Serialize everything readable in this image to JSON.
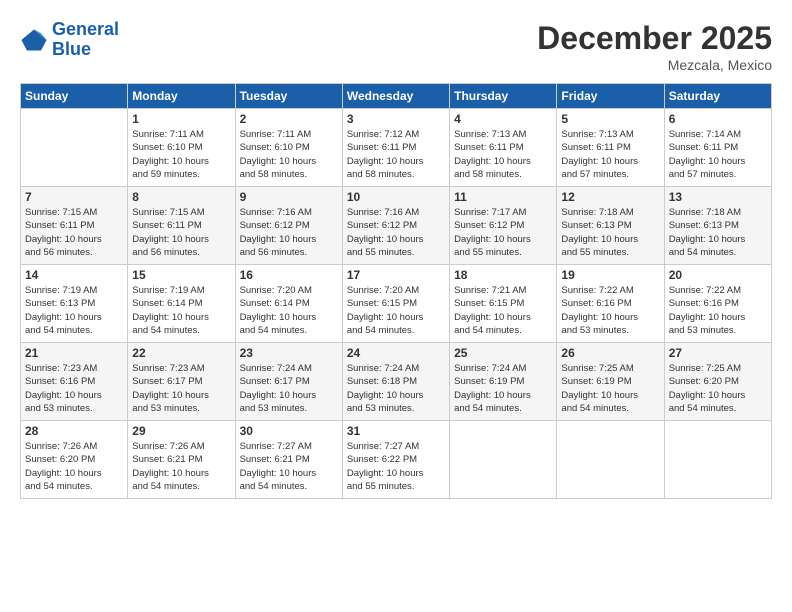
{
  "logo": {
    "line1": "General",
    "line2": "Blue"
  },
  "title": "December 2025",
  "location": "Mezcala, Mexico",
  "days_of_week": [
    "Sunday",
    "Monday",
    "Tuesday",
    "Wednesday",
    "Thursday",
    "Friday",
    "Saturday"
  ],
  "weeks": [
    [
      {
        "num": "",
        "sunrise": "",
        "sunset": "",
        "daylight": ""
      },
      {
        "num": "1",
        "sunrise": "Sunrise: 7:11 AM",
        "sunset": "Sunset: 6:10 PM",
        "daylight": "Daylight: 10 hours and 59 minutes."
      },
      {
        "num": "2",
        "sunrise": "Sunrise: 7:11 AM",
        "sunset": "Sunset: 6:10 PM",
        "daylight": "Daylight: 10 hours and 58 minutes."
      },
      {
        "num": "3",
        "sunrise": "Sunrise: 7:12 AM",
        "sunset": "Sunset: 6:11 PM",
        "daylight": "Daylight: 10 hours and 58 minutes."
      },
      {
        "num": "4",
        "sunrise": "Sunrise: 7:13 AM",
        "sunset": "Sunset: 6:11 PM",
        "daylight": "Daylight: 10 hours and 58 minutes."
      },
      {
        "num": "5",
        "sunrise": "Sunrise: 7:13 AM",
        "sunset": "Sunset: 6:11 PM",
        "daylight": "Daylight: 10 hours and 57 minutes."
      },
      {
        "num": "6",
        "sunrise": "Sunrise: 7:14 AM",
        "sunset": "Sunset: 6:11 PM",
        "daylight": "Daylight: 10 hours and 57 minutes."
      }
    ],
    [
      {
        "num": "7",
        "sunrise": "Sunrise: 7:15 AM",
        "sunset": "Sunset: 6:11 PM",
        "daylight": "Daylight: 10 hours and 56 minutes."
      },
      {
        "num": "8",
        "sunrise": "Sunrise: 7:15 AM",
        "sunset": "Sunset: 6:11 PM",
        "daylight": "Daylight: 10 hours and 56 minutes."
      },
      {
        "num": "9",
        "sunrise": "Sunrise: 7:16 AM",
        "sunset": "Sunset: 6:12 PM",
        "daylight": "Daylight: 10 hours and 56 minutes."
      },
      {
        "num": "10",
        "sunrise": "Sunrise: 7:16 AM",
        "sunset": "Sunset: 6:12 PM",
        "daylight": "Daylight: 10 hours and 55 minutes."
      },
      {
        "num": "11",
        "sunrise": "Sunrise: 7:17 AM",
        "sunset": "Sunset: 6:12 PM",
        "daylight": "Daylight: 10 hours and 55 minutes."
      },
      {
        "num": "12",
        "sunrise": "Sunrise: 7:18 AM",
        "sunset": "Sunset: 6:13 PM",
        "daylight": "Daylight: 10 hours and 55 minutes."
      },
      {
        "num": "13",
        "sunrise": "Sunrise: 7:18 AM",
        "sunset": "Sunset: 6:13 PM",
        "daylight": "Daylight: 10 hours and 54 minutes."
      }
    ],
    [
      {
        "num": "14",
        "sunrise": "Sunrise: 7:19 AM",
        "sunset": "Sunset: 6:13 PM",
        "daylight": "Daylight: 10 hours and 54 minutes."
      },
      {
        "num": "15",
        "sunrise": "Sunrise: 7:19 AM",
        "sunset": "Sunset: 6:14 PM",
        "daylight": "Daylight: 10 hours and 54 minutes."
      },
      {
        "num": "16",
        "sunrise": "Sunrise: 7:20 AM",
        "sunset": "Sunset: 6:14 PM",
        "daylight": "Daylight: 10 hours and 54 minutes."
      },
      {
        "num": "17",
        "sunrise": "Sunrise: 7:20 AM",
        "sunset": "Sunset: 6:15 PM",
        "daylight": "Daylight: 10 hours and 54 minutes."
      },
      {
        "num": "18",
        "sunrise": "Sunrise: 7:21 AM",
        "sunset": "Sunset: 6:15 PM",
        "daylight": "Daylight: 10 hours and 54 minutes."
      },
      {
        "num": "19",
        "sunrise": "Sunrise: 7:22 AM",
        "sunset": "Sunset: 6:16 PM",
        "daylight": "Daylight: 10 hours and 53 minutes."
      },
      {
        "num": "20",
        "sunrise": "Sunrise: 7:22 AM",
        "sunset": "Sunset: 6:16 PM",
        "daylight": "Daylight: 10 hours and 53 minutes."
      }
    ],
    [
      {
        "num": "21",
        "sunrise": "Sunrise: 7:23 AM",
        "sunset": "Sunset: 6:16 PM",
        "daylight": "Daylight: 10 hours and 53 minutes."
      },
      {
        "num": "22",
        "sunrise": "Sunrise: 7:23 AM",
        "sunset": "Sunset: 6:17 PM",
        "daylight": "Daylight: 10 hours and 53 minutes."
      },
      {
        "num": "23",
        "sunrise": "Sunrise: 7:24 AM",
        "sunset": "Sunset: 6:17 PM",
        "daylight": "Daylight: 10 hours and 53 minutes."
      },
      {
        "num": "24",
        "sunrise": "Sunrise: 7:24 AM",
        "sunset": "Sunset: 6:18 PM",
        "daylight": "Daylight: 10 hours and 53 minutes."
      },
      {
        "num": "25",
        "sunrise": "Sunrise: 7:24 AM",
        "sunset": "Sunset: 6:19 PM",
        "daylight": "Daylight: 10 hours and 54 minutes."
      },
      {
        "num": "26",
        "sunrise": "Sunrise: 7:25 AM",
        "sunset": "Sunset: 6:19 PM",
        "daylight": "Daylight: 10 hours and 54 minutes."
      },
      {
        "num": "27",
        "sunrise": "Sunrise: 7:25 AM",
        "sunset": "Sunset: 6:20 PM",
        "daylight": "Daylight: 10 hours and 54 minutes."
      }
    ],
    [
      {
        "num": "28",
        "sunrise": "Sunrise: 7:26 AM",
        "sunset": "Sunset: 6:20 PM",
        "daylight": "Daylight: 10 hours and 54 minutes."
      },
      {
        "num": "29",
        "sunrise": "Sunrise: 7:26 AM",
        "sunset": "Sunset: 6:21 PM",
        "daylight": "Daylight: 10 hours and 54 minutes."
      },
      {
        "num": "30",
        "sunrise": "Sunrise: 7:27 AM",
        "sunset": "Sunset: 6:21 PM",
        "daylight": "Daylight: 10 hours and 54 minutes."
      },
      {
        "num": "31",
        "sunrise": "Sunrise: 7:27 AM",
        "sunset": "Sunset: 6:22 PM",
        "daylight": "Daylight: 10 hours and 55 minutes."
      },
      {
        "num": "",
        "sunrise": "",
        "sunset": "",
        "daylight": ""
      },
      {
        "num": "",
        "sunrise": "",
        "sunset": "",
        "daylight": ""
      },
      {
        "num": "",
        "sunrise": "",
        "sunset": "",
        "daylight": ""
      }
    ]
  ]
}
